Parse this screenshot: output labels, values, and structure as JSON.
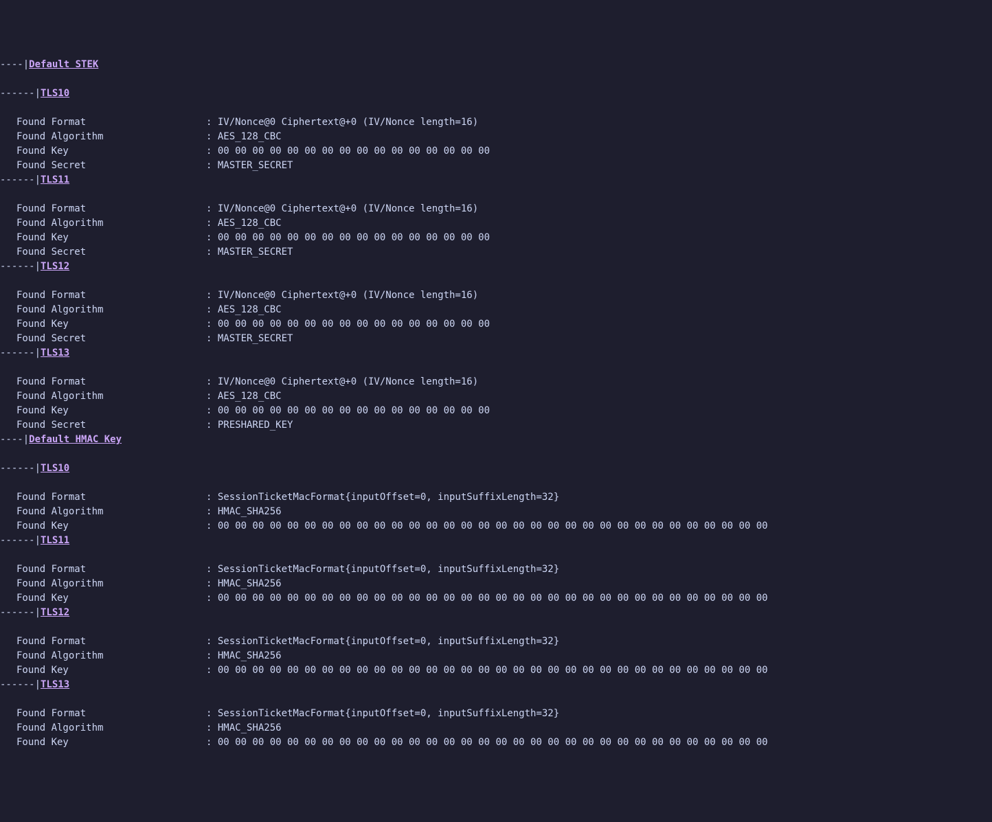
{
  "sections": [
    {
      "heading_prefix": "----|",
      "heading": "Default STEK",
      "subsections": [
        {
          "heading_prefix": "------|",
          "heading": "TLS10",
          "rows": [
            {
              "label": "Found Format",
              "value": "IV/Nonce@0 Ciphertext@+0 (IV/Nonce length=16)"
            },
            {
              "label": "Found Algorithm",
              "value": "AES_128_CBC"
            },
            {
              "label": "Found Key",
              "value": "00 00 00 00 00 00 00 00 00 00 00 00 00 00 00 00"
            },
            {
              "label": "Found Secret",
              "value": "MASTER_SECRET"
            }
          ]
        },
        {
          "heading_prefix": "------|",
          "heading": "TLS11",
          "rows": [
            {
              "label": "Found Format",
              "value": "IV/Nonce@0 Ciphertext@+0 (IV/Nonce length=16)"
            },
            {
              "label": "Found Algorithm",
              "value": "AES_128_CBC"
            },
            {
              "label": "Found Key",
              "value": "00 00 00 00 00 00 00 00 00 00 00 00 00 00 00 00"
            },
            {
              "label": "Found Secret",
              "value": "MASTER_SECRET"
            }
          ]
        },
        {
          "heading_prefix": "------|",
          "heading": "TLS12",
          "rows": [
            {
              "label": "Found Format",
              "value": "IV/Nonce@0 Ciphertext@+0 (IV/Nonce length=16)"
            },
            {
              "label": "Found Algorithm",
              "value": "AES_128_CBC"
            },
            {
              "label": "Found Key",
              "value": "00 00 00 00 00 00 00 00 00 00 00 00 00 00 00 00"
            },
            {
              "label": "Found Secret",
              "value": "MASTER_SECRET"
            }
          ]
        },
        {
          "heading_prefix": "------|",
          "heading": "TLS13",
          "rows": [
            {
              "label": "Found Format",
              "value": "IV/Nonce@0 Ciphertext@+0 (IV/Nonce length=16)"
            },
            {
              "label": "Found Algorithm",
              "value": "AES_128_CBC"
            },
            {
              "label": "Found Key",
              "value": "00 00 00 00 00 00 00 00 00 00 00 00 00 00 00 00"
            },
            {
              "label": "Found Secret",
              "value": "PRESHARED_KEY"
            }
          ]
        }
      ]
    },
    {
      "heading_prefix": "----|",
      "heading": "Default HMAC Key",
      "subsections": [
        {
          "heading_prefix": "------|",
          "heading": "TLS10",
          "rows": [
            {
              "label": "Found Format",
              "value": "SessionTicketMacFormat{inputOffset=0, inputSuffixLength=32}"
            },
            {
              "label": "Found Algorithm",
              "value": "HMAC_SHA256"
            },
            {
              "label": "Found Key",
              "value": "00 00 00 00 00 00 00 00 00 00 00 00 00 00 00 00 00 00 00 00 00 00 00 00 00 00 00 00 00 00 00 00"
            }
          ]
        },
        {
          "heading_prefix": "------|",
          "heading": "TLS11",
          "rows": [
            {
              "label": "Found Format",
              "value": "SessionTicketMacFormat{inputOffset=0, inputSuffixLength=32}"
            },
            {
              "label": "Found Algorithm",
              "value": "HMAC_SHA256"
            },
            {
              "label": "Found Key",
              "value": "00 00 00 00 00 00 00 00 00 00 00 00 00 00 00 00 00 00 00 00 00 00 00 00 00 00 00 00 00 00 00 00"
            }
          ]
        },
        {
          "heading_prefix": "------|",
          "heading": "TLS12",
          "rows": [
            {
              "label": "Found Format",
              "value": "SessionTicketMacFormat{inputOffset=0, inputSuffixLength=32}"
            },
            {
              "label": "Found Algorithm",
              "value": "HMAC_SHA256"
            },
            {
              "label": "Found Key",
              "value": "00 00 00 00 00 00 00 00 00 00 00 00 00 00 00 00 00 00 00 00 00 00 00 00 00 00 00 00 00 00 00 00"
            }
          ]
        },
        {
          "heading_prefix": "------|",
          "heading": "TLS13",
          "rows": [
            {
              "label": "Found Format",
              "value": "SessionTicketMacFormat{inputOffset=0, inputSuffixLength=32}"
            },
            {
              "label": "Found Algorithm",
              "value": "HMAC_SHA256"
            },
            {
              "label": "Found Key",
              "value": "00 00 00 00 00 00 00 00 00 00 00 00 00 00 00 00 00 00 00 00 00 00 00 00 00 00 00 00 00 00 00 00"
            }
          ]
        }
      ]
    }
  ]
}
